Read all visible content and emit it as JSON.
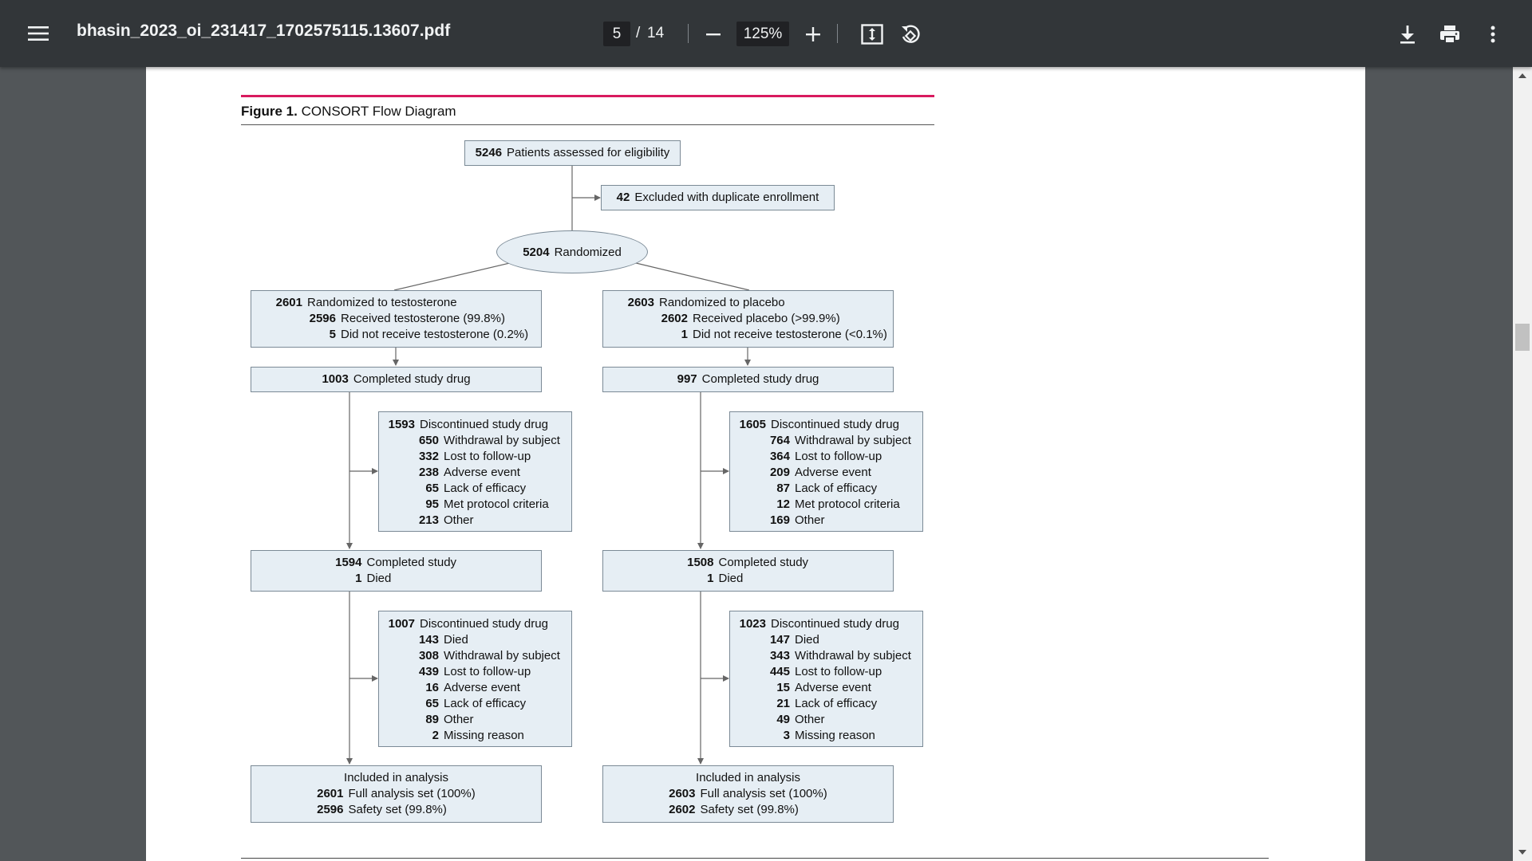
{
  "toolbar": {
    "filename": "bhasin_2023_oi_231417_1702575115.13607.pdf",
    "current_page": "5",
    "page_separator": "/",
    "total_pages": "14",
    "zoom": "125%"
  },
  "figure": {
    "label": "Figure 1.",
    "title": "CONSORT Flow Diagram",
    "assessed": {
      "num": "5246",
      "text": "Patients assessed for eligibility"
    },
    "excluded": {
      "num": "42",
      "text": "Excluded with duplicate enrollment"
    },
    "randomized": {
      "num": "5204",
      "text": "Randomized"
    },
    "testosterone_arm": {
      "allocation": [
        {
          "num": "2601",
          "text": "Randomized to testosterone"
        },
        {
          "num": "2596",
          "text": "Received testosterone (99.8%)"
        },
        {
          "num": "5",
          "text": "Did not receive testosterone (0.2%)"
        }
      ],
      "completed_drug": {
        "num": "1003",
        "text": "Completed study drug"
      },
      "discontinued_drug": [
        {
          "num": "1593",
          "text": "Discontinued study drug"
        },
        {
          "num": "650",
          "text": "Withdrawal by subject"
        },
        {
          "num": "332",
          "text": "Lost to follow-up"
        },
        {
          "num": "238",
          "text": "Adverse event"
        },
        {
          "num": "65",
          "text": "Lack of efficacy"
        },
        {
          "num": "95",
          "text": "Met protocol criteria"
        },
        {
          "num": "213",
          "text": "Other"
        }
      ],
      "completed_study": [
        {
          "num": "1594",
          "text": "Completed study"
        },
        {
          "num": "1",
          "text": "Died"
        }
      ],
      "discontinued_study": [
        {
          "num": "1007",
          "text": "Discontinued study drug"
        },
        {
          "num": "143",
          "text": "Died"
        },
        {
          "num": "308",
          "text": "Withdrawal by subject"
        },
        {
          "num": "439",
          "text": "Lost to follow-up"
        },
        {
          "num": "16",
          "text": "Adverse event"
        },
        {
          "num": "65",
          "text": "Lack of efficacy"
        },
        {
          "num": "89",
          "text": "Other"
        },
        {
          "num": "2",
          "text": "Missing reason"
        }
      ],
      "analysis_heading": "Included in analysis",
      "analysis": [
        {
          "num": "2601",
          "text": "Full analysis set (100%)"
        },
        {
          "num": "2596",
          "text": "Safety set (99.8%)"
        }
      ]
    },
    "placebo_arm": {
      "allocation": [
        {
          "num": "2603",
          "text": "Randomized to placebo"
        },
        {
          "num": "2602",
          "text": "Received placebo (>99.9%)"
        },
        {
          "num": "1",
          "text": "Did not receive testosterone (<0.1%)"
        }
      ],
      "completed_drug": {
        "num": "997",
        "text": "Completed study drug"
      },
      "discontinued_drug": [
        {
          "num": "1605",
          "text": "Discontinued study drug"
        },
        {
          "num": "764",
          "text": "Withdrawal by subject"
        },
        {
          "num": "364",
          "text": "Lost to follow-up"
        },
        {
          "num": "209",
          "text": "Adverse event"
        },
        {
          "num": "87",
          "text": "Lack of efficacy"
        },
        {
          "num": "12",
          "text": "Met protocol criteria"
        },
        {
          "num": "169",
          "text": "Other"
        }
      ],
      "completed_study": [
        {
          "num": "1508",
          "text": "Completed study"
        },
        {
          "num": "1",
          "text": "Died"
        }
      ],
      "discontinued_study": [
        {
          "num": "1023",
          "text": "Discontinued study drug"
        },
        {
          "num": "147",
          "text": "Died"
        },
        {
          "num": "343",
          "text": "Withdrawal by subject"
        },
        {
          "num": "445",
          "text": "Lost to follow-up"
        },
        {
          "num": "15",
          "text": "Adverse event"
        },
        {
          "num": "21",
          "text": "Lack of efficacy"
        },
        {
          "num": "49",
          "text": "Other"
        },
        {
          "num": "3",
          "text": "Missing reason"
        }
      ],
      "analysis_heading": "Included in analysis",
      "analysis": [
        {
          "num": "2603",
          "text": "Full analysis set (100%)"
        },
        {
          "num": "2602",
          "text": "Safety set (99.8%)"
        }
      ]
    }
  }
}
